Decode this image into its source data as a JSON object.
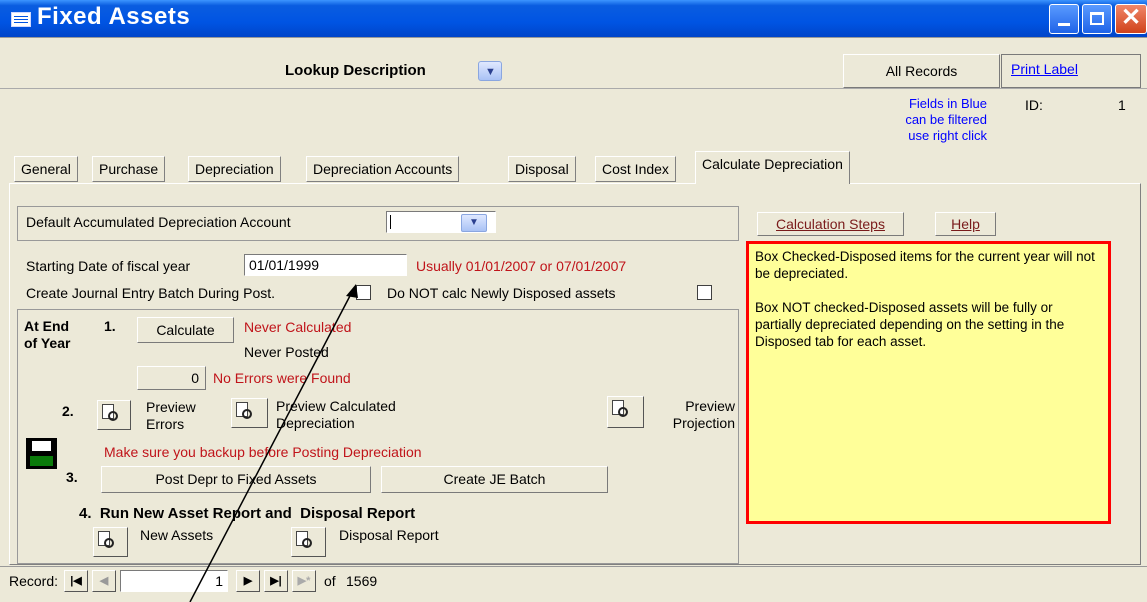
{
  "window": {
    "title": "Fixed Assets",
    "icon": "form-icon",
    "minimize": "minimize-icon",
    "maximize": "maximize-icon",
    "close": "close-icon"
  },
  "header": {
    "lookup_label": "Lookup Description",
    "lookup_value": "",
    "all_records": "All Records",
    "print_label": "Print Label",
    "filter_note": [
      "Fields in Blue",
      "can be filtered",
      "use right click"
    ],
    "id_label": "ID:",
    "id_value": "1"
  },
  "tabs": [
    "General",
    "Purchase",
    "Depreciation",
    "Depreciation Accounts",
    "Disposal",
    "Cost Index",
    "Calculate Depreciation"
  ],
  "active_tab": "Calculate Depreciation",
  "form": {
    "default_account_label": "Default Accumulated Depreciation Account",
    "default_account_value": "",
    "calculation_steps": "Calculation Steps",
    "help": "Help",
    "starting_date_label": "Starting Date of fiscal year",
    "starting_date_value": "01/01/1999",
    "starting_date_hint": "Usually 01/01/2007 or 07/01/2007",
    "journal_batch_label": "Create Journal Entry Batch During Post.",
    "journal_batch_checked": false,
    "no_calc_disposed_label": "Do NOT calc Newly Disposed assets",
    "no_calc_disposed_checked": false,
    "info_box": {
      "para1": "Box Checked-Disposed items for the current year will not be depreciated.",
      "para2": "Box NOT checked-Disposed assets will be fully or partially depreciated depending on the setting in the Disposed tab for each asset."
    }
  },
  "year_end": {
    "heading_line1": "At End",
    "heading_line2": "of Year",
    "step1": "1.",
    "calculate": "Calculate",
    "calc_status": "Never Calculated",
    "post_status": "Never Posted",
    "error_count": "0",
    "error_status": "No Errors were Found",
    "step2": "2.",
    "preview_errors": [
      "Preview",
      "Errors"
    ],
    "preview_calculated": [
      "Preview Calculated",
      "Depreciation"
    ],
    "preview_projection": [
      "Preview",
      "Projection"
    ],
    "backup_warning": "Make sure you backup before Posting Depreciation",
    "step3": "3.",
    "post_button": "Post Depr to Fixed Assets",
    "je_button": "Create JE Batch",
    "step4": "4.  Run New Asset Report and  Disposal Report",
    "new_assets": "New Assets",
    "disposal_report": "Disposal Report"
  },
  "record_nav": {
    "label": "Record:",
    "current": "1",
    "of_label": "of",
    "total": "1569"
  },
  "colors": {
    "title_blue": "#0054e3",
    "info_yellow": "#ffff99",
    "info_border": "#ff0000",
    "note_red": "#c0141a",
    "note_blue": "#0000ff"
  }
}
